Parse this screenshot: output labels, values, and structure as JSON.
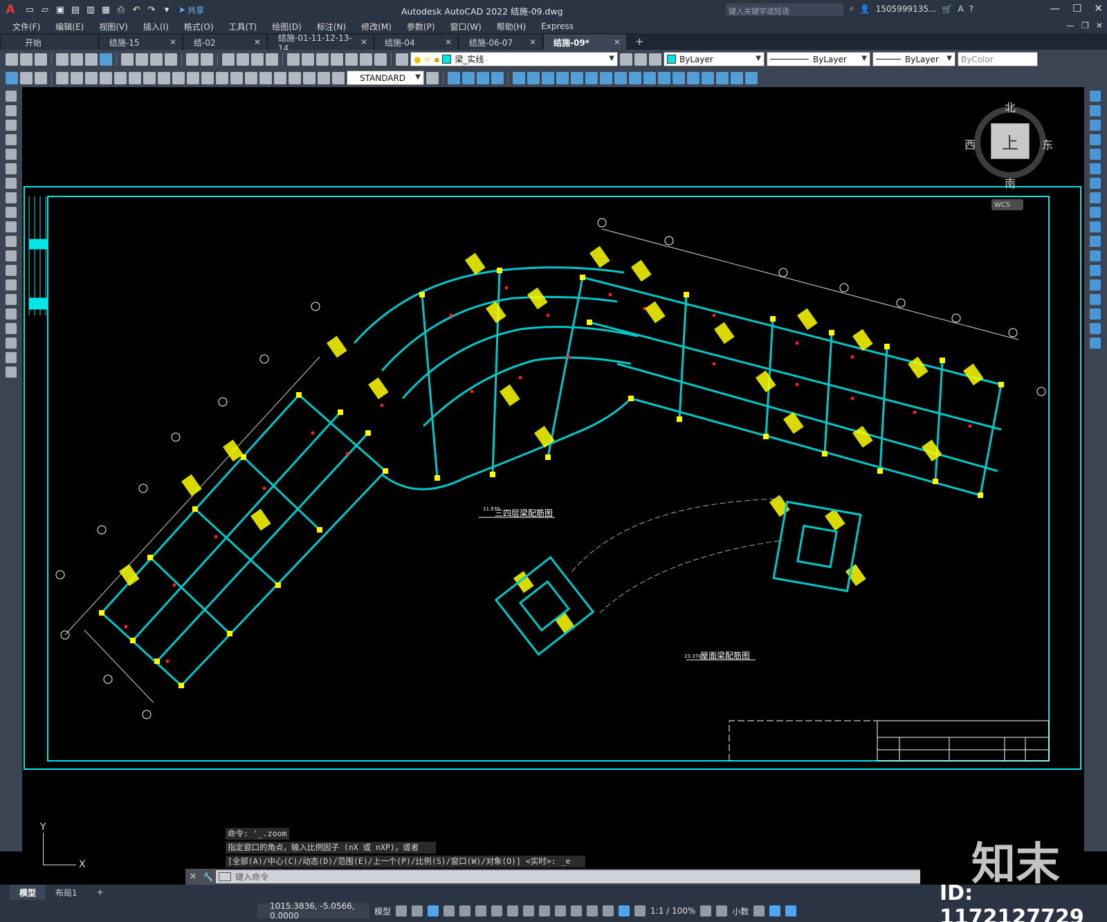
{
  "app": {
    "logo": "A",
    "title": "Autodesk AutoCAD 2022    结施-09.dwg",
    "share_label": "共享",
    "search_placeholder": "键入关键字或短语",
    "user": "1505999135...",
    "help": "?"
  },
  "menu": [
    "文件(F)",
    "编辑(E)",
    "视图(V)",
    "插入(I)",
    "格式(O)",
    "工具(T)",
    "绘图(D)",
    "标注(N)",
    "修改(M)",
    "参数(P)",
    "窗口(W)",
    "帮助(H)",
    "Express"
  ],
  "tabs": [
    {
      "label": "开始",
      "active": false
    },
    {
      "label": "结施-15",
      "active": false
    },
    {
      "label": "结-02",
      "active": false
    },
    {
      "label": "结施-01-11-12-13-14",
      "active": false
    },
    {
      "label": "结施-04",
      "active": false
    },
    {
      "label": "结施-06-07",
      "active": false
    },
    {
      "label": "结施-09*",
      "active": true
    }
  ],
  "toolbar": {
    "layer_name": "梁_实线",
    "layer_color": "#00e5e5",
    "color_value": "ByLayer",
    "linetype_value": "ByLayer",
    "lineweight_value": "ByLayer",
    "plotstyle_value": "ByColor",
    "textstyle_value": "STANDARD"
  },
  "viewcube": {
    "north": "北",
    "south": "南",
    "east": "东",
    "west": "西",
    "face": "上",
    "wcs_label": "WCS"
  },
  "drawing": {
    "title_floor": "三四层梁配筋图",
    "title_roof": "屋面梁配筋图",
    "elev_floor": "11.970",
    "elev_roof": "23.370",
    "colors": {
      "frame": "#00e5e5",
      "beam": "#00c8c8",
      "label": "#ffff00",
      "grid": "#ffffff",
      "column": "#ffff00",
      "mark": "#ff2020"
    }
  },
  "command": {
    "history": [
      "命令: '_.zoom",
      "指定窗口的角点，输入比例因子 (nX 或 nXP)，或者",
      "[全部(A)/中心(C)/动态(D)/范围(E)/上一个(P)/比例(S)/窗口(W)/对象(O)] <实时>: _e"
    ],
    "placeholder": "键入命令"
  },
  "ucs": {
    "x": "X",
    "y": "Y"
  },
  "layouts": [
    {
      "label": "模型",
      "active": true
    },
    {
      "label": "布局1",
      "active": false
    }
  ],
  "status": {
    "coords": "1015.3836, -5.0566, 0.0000",
    "mode": "模型",
    "scale": "1:1 / 100%",
    "units": "小数"
  },
  "watermark": {
    "brand": "知末",
    "id": "ID: 1172127729"
  }
}
